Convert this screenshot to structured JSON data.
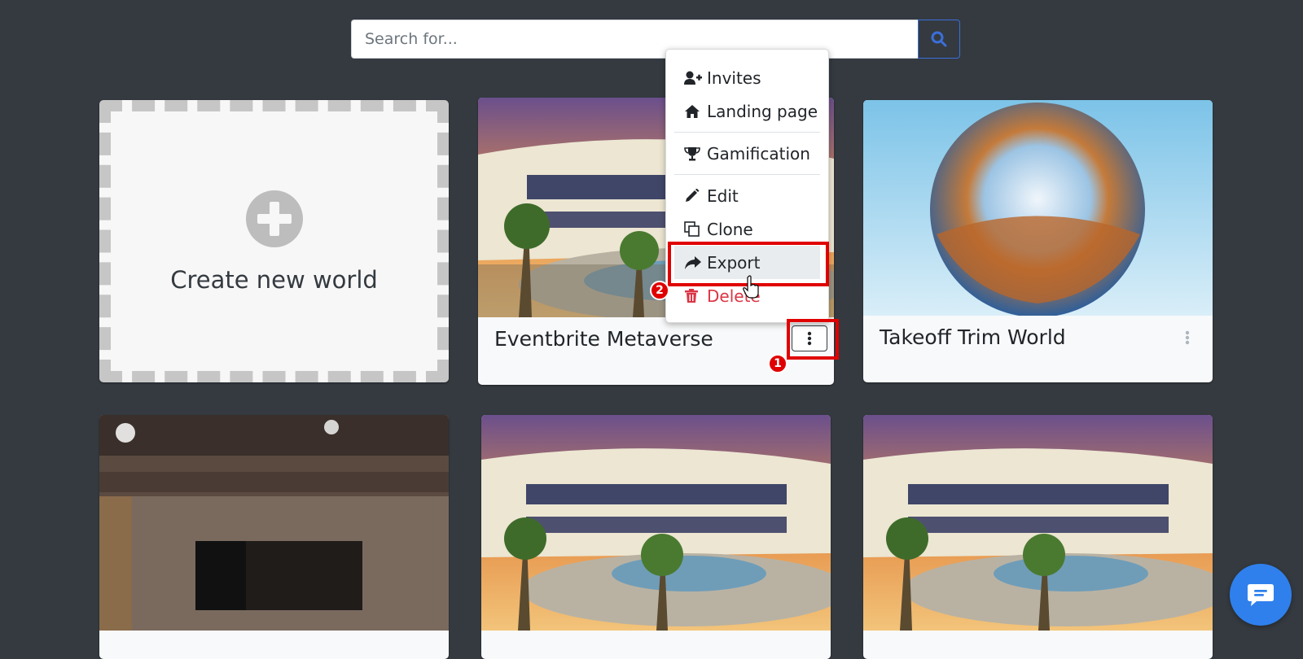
{
  "search": {
    "placeholder": "Search for..."
  },
  "create_card": {
    "label": "Create new world"
  },
  "worlds": [
    {
      "title": "Eventbrite Metaverse"
    },
    {
      "title": "Takeoff Trim World"
    }
  ],
  "menu": {
    "items": [
      {
        "label": "Invites",
        "icon": "user-plus-icon"
      },
      {
        "label": "Landing page",
        "icon": "home-icon"
      },
      {
        "label": "Gamification",
        "icon": "trophy-icon"
      },
      {
        "label": "Edit",
        "icon": "pencil-icon"
      },
      {
        "label": "Clone",
        "icon": "clone-icon"
      },
      {
        "label": "Export",
        "icon": "share-icon"
      },
      {
        "label": "Delete",
        "icon": "trash-icon"
      }
    ]
  },
  "callouts": {
    "step1": "1",
    "step2": "2"
  },
  "colors": {
    "accent": "#2f80ed",
    "danger": "#dc3545",
    "callout": "#e00000",
    "background": "#343a40"
  }
}
